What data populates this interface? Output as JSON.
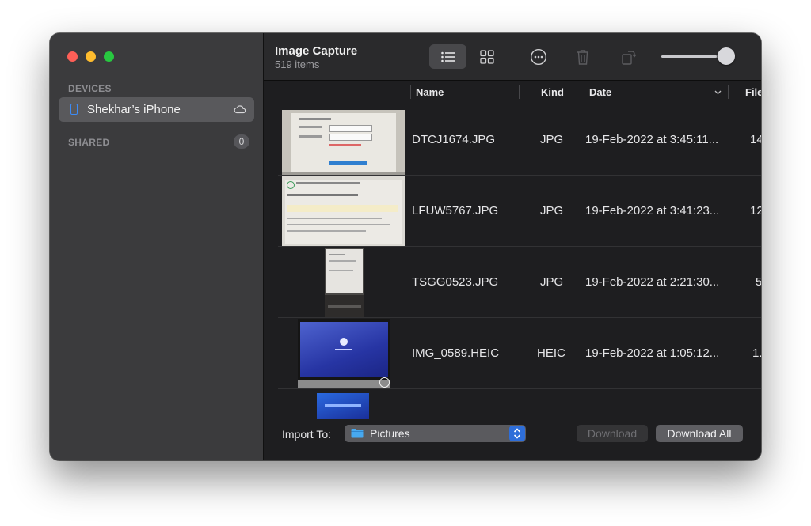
{
  "sidebar": {
    "devices_label": "DEVICES",
    "device_name": "Shekhar’s iPhone",
    "shared_label": "SHARED",
    "shared_count": "0"
  },
  "toolbar": {
    "title": "Image Capture",
    "item_count": "519 items",
    "icons": [
      "list-view-icon",
      "grid-view-icon",
      "more-icon",
      "trash-icon",
      "rotate-icon"
    ],
    "thumbnail_size_fraction": 0.8
  },
  "columns": [
    "Name",
    "Kind",
    "Date",
    "File"
  ],
  "files": [
    {
      "name": "DTCJ1674.JPG",
      "kind": "JPG",
      "date": "19-Feb-2022 at 3:45:11...",
      "size": "14"
    },
    {
      "name": "LFUW5767.JPG",
      "kind": "JPG",
      "date": "19-Feb-2022 at 3:41:23...",
      "size": "12"
    },
    {
      "name": "TSGG0523.JPG",
      "kind": "JPG",
      "date": "19-Feb-2022 at 2:21:30...",
      "size": "5"
    },
    {
      "name": "IMG_0589.HEIC",
      "kind": "HEIC",
      "date": "19-Feb-2022 at 1:05:12...",
      "size": "1."
    }
  ],
  "bottom": {
    "import_label": "Import To:",
    "destination": "Pictures",
    "download_label": "Download",
    "download_all_label": "Download All"
  }
}
